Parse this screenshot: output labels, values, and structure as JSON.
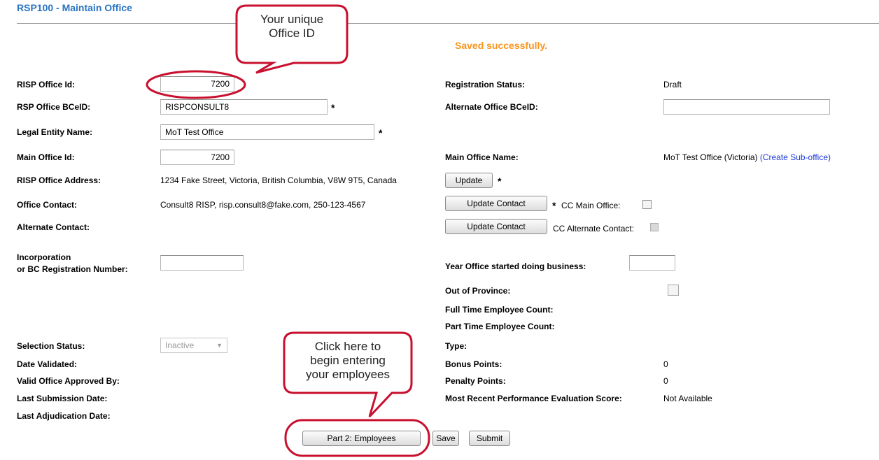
{
  "page": {
    "title": "RSP100 - Maintain Office",
    "status_message": "Saved successfully."
  },
  "callouts": {
    "office_id": "Your unique\nOffice ID",
    "employees": "Click here to\nbegin entering\nyour employees"
  },
  "left": {
    "risp_office_id": {
      "label": "RISP Office Id:",
      "value": "7200"
    },
    "rsp_office_bceid": {
      "label": "RSP Office BCeID:",
      "value": "RISPCONSULT8"
    },
    "legal_entity_name": {
      "label": "Legal Entity Name:",
      "value": "MoT Test Office"
    },
    "main_office_id": {
      "label": "Main Office Id:",
      "value": "7200"
    },
    "risp_office_address": {
      "label": "RISP Office Address:",
      "value": "1234 Fake Street, Victoria, British Columbia, V8W 9T5, Canada"
    },
    "office_contact": {
      "label": "Office Contact:",
      "value": "Consult8 RISP, risp.consult8@fake.com, 250-123-4567"
    },
    "alternate_contact": {
      "label": "Alternate Contact:"
    },
    "incorporation": {
      "label_line1": "Incorporation",
      "label_line2": "or BC Registration Number:",
      "value": ""
    },
    "selection_status": {
      "label": "Selection Status:",
      "value": "Inactive"
    },
    "date_validated": {
      "label": "Date Validated:"
    },
    "valid_office_approved_by": {
      "label": "Valid Office Approved By:"
    },
    "last_submission_date": {
      "label": "Last Submission Date:"
    },
    "last_adjudication_date": {
      "label": "Last Adjudication Date:"
    }
  },
  "right": {
    "registration_status": {
      "label": "Registration Status:",
      "value": "Draft"
    },
    "alternate_office_bceid": {
      "label": "Alternate Office BCeID:",
      "value": ""
    },
    "main_office_name": {
      "label": "Main Office Name:",
      "value": "MoT Test Office (Victoria)",
      "link": "(Create Sub-office)"
    },
    "year_started": {
      "label": "Year Office started doing business:",
      "value": ""
    },
    "out_of_province": {
      "label": "Out of Province:"
    },
    "full_time_count": {
      "label": "Full Time Employee Count:"
    },
    "part_time_count": {
      "label": "Part Time Employee Count:"
    },
    "type": {
      "label": "Type:"
    },
    "bonus_points": {
      "label": "Bonus Points:",
      "value": "0"
    },
    "penalty_points": {
      "label": "Penalty Points:",
      "value": "0"
    },
    "performance_score": {
      "label": "Most Recent Performance Evaluation Score:",
      "value": "Not Available"
    }
  },
  "buttons": {
    "update": "Update",
    "update_contact": "Update Contact",
    "update_alt_contact": "Update Contact",
    "part2": "Part 2: Employees",
    "save": "Save",
    "submit": "Submit"
  },
  "checkboxes": {
    "cc_main_office": "CC Main Office:",
    "cc_alternate_contact": "CC Alternate Contact:"
  },
  "required_marker": "*",
  "colors": {
    "title": "#2a74c2",
    "status": "#f7941d",
    "callout_border": "#c8102e",
    "link": "#1e3ad6"
  }
}
